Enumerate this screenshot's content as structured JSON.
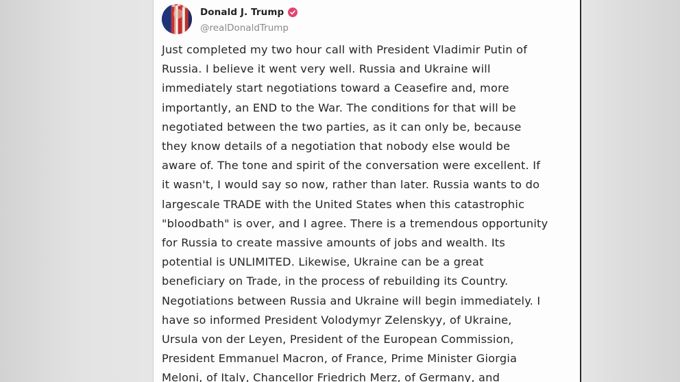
{
  "post": {
    "author_name": "Donald J. Trump",
    "author_handle": "@realDonaldTrump",
    "verified_icon": "verified-badge-icon",
    "avatar_icon": "profile-avatar",
    "lines": [
      "Just completed my two hour call with President Vladimir Putin of",
      "Russia. I believe it went very well. Russia and Ukraine will",
      "immediately start negotiations toward a Ceasefire and, more",
      "importantly, an END to the War. The conditions for that will be",
      "negotiated between the two parties, as it can only be, because",
      "they know details of a negotiation that nobody else would be",
      "aware of. The tone and spirit of the conversation were excellent. If",
      "it wasn't, I would say so now, rather than later. Russia wants to do",
      "largescale TRADE with the United States when this catastrophic",
      "\"bloodbath\" is over, and I agree. There is a tremendous opportunity",
      "for Russia to create massive amounts of jobs and wealth. Its",
      "potential is UNLIMITED. Likewise, Ukraine can be a great",
      "beneficiary on Trade, in the process of rebuilding its Country.",
      "Negotiations between Russia and Ukraine will begin immediately. I",
      "have so informed President Volodymyr Zelenskyy, of Ukraine,",
      "Ursula von der Leyen, President of the European Commission,",
      "President Emmanuel Macron, of France, Prime Minister Giorgia",
      "Meloni, of Italy, Chancellor Friedrich Merz, of Germany, and"
    ]
  },
  "colors": {
    "verified_badge": "#e04470",
    "card_background": "#fdfdfd",
    "side_background": "#dcdcdc"
  }
}
